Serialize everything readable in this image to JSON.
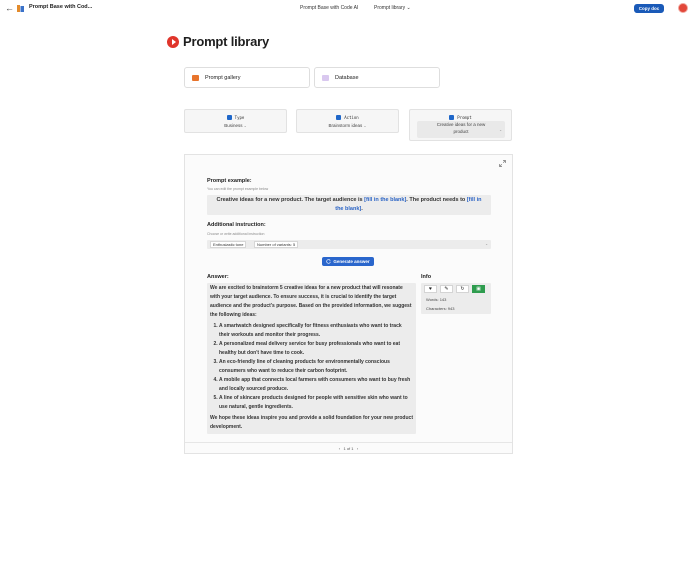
{
  "topbar": {
    "back_glyph": "←",
    "doc_icon": "doc-icon",
    "doc_title": "Prompt Base with Cod...",
    "center_title": "Prompt Base with Code AI",
    "page_menu_label": "Prompt library",
    "page_menu_caret": "⌄",
    "copy_button": "Copy doc"
  },
  "heading": {
    "icon": "play-icon",
    "title": "Prompt library"
  },
  "links": {
    "gallery": "Prompt gallery",
    "database": "Database"
  },
  "selectors": {
    "type": {
      "label": "Type",
      "value": "Business"
    },
    "action": {
      "label": "Action",
      "value": "Brainstorm ideas"
    },
    "prompt": {
      "label": "Prompt",
      "value_line1": "Creative ideas for a new",
      "value_line2": "product"
    },
    "caret": "⌄"
  },
  "example": {
    "label": "Prompt example:",
    "hint": "You can edit the prompt example below",
    "text_1": "Creative ideas for a new product. The target audience is ",
    "blank_1": "[fill in the blank]",
    "text_2": ". The product needs to ",
    "blank_2a": "[fill in",
    "blank_2b": "the blank]",
    "text_3": "."
  },
  "instruction": {
    "label": "Additional instruction:",
    "hint": "Choose or write additional instruction",
    "chip_1": "Enthusiastic tone",
    "chip_2": "Number of variants: 5"
  },
  "generate_button": "Generate answer",
  "answer": {
    "label": "Answer:",
    "intro": "We are excited to brainstorm 5 creative ideas for a new product that will resonate with your target audience. To ensure success, it is crucial to identify the target audience and the product's purpose. Based on the provided information, we suggest the following ideas:",
    "items": [
      "A smartwatch designed specifically for fitness enthusiasts who want to track their workouts and monitor their progress.",
      "A personalized meal delivery service for busy professionals who want to eat healthy but don't have time to cook.",
      "An eco-friendly line of cleaning products for environmentally conscious consumers who want to reduce their carbon footprint.",
      "A mobile app that connects local farmers with consumers who want to buy fresh and locally sourced produce.",
      "A line of skincare products designed for people with sensitive skin who want to use natural, gentle ingredients."
    ],
    "outro": "We hope these ideas inspire you and provide a solid foundation for your new product development."
  },
  "info": {
    "label": "Info",
    "words": "Words: 143",
    "characters": "Characters: 943",
    "tools": [
      "heart-icon",
      "edit-icon",
      "refresh-icon",
      "insert-icon"
    ]
  },
  "pager": {
    "prev": "‹",
    "text": "1 of 1",
    "next": "›"
  },
  "colors": {
    "accent_blue": "#1a5ab8",
    "brand_red": "#e0352b",
    "insert_green": "#2e9c4e",
    "blank_link": "#2a63c5"
  }
}
